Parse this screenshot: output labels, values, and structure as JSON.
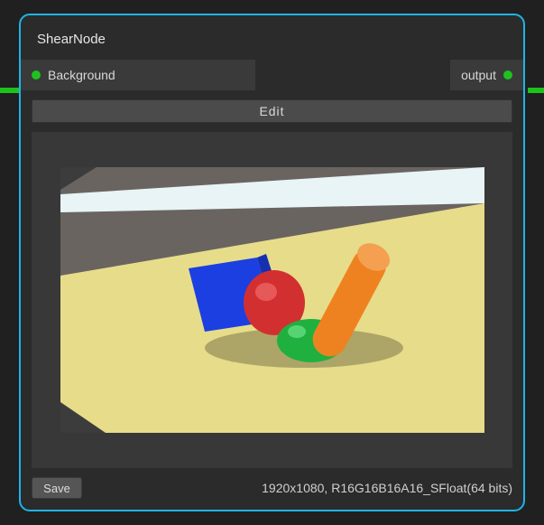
{
  "node": {
    "title": "ShearNode",
    "edit_label": "Edit"
  },
  "ports": {
    "input": {
      "label": "Background"
    },
    "output": {
      "label": "output"
    }
  },
  "footer": {
    "save_label": "Save",
    "info": "1920x1080, R16G16B16A16_SFloat(64 bits)"
  },
  "colors": {
    "accent_border": "#1eb4e6",
    "wire": "#1ec21e"
  }
}
